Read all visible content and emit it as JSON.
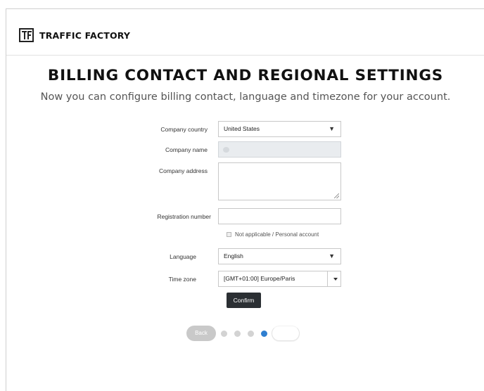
{
  "brand": {
    "logo_icon": "tf-logo-icon",
    "name": "TRAFFIC FACTORY"
  },
  "page": {
    "title": "BILLING CONTACT AND REGIONAL SETTINGS",
    "subtitle": "Now you can configure billing contact, language and timezone for your account."
  },
  "form": {
    "company_country": {
      "label": "Company country",
      "value": "United States"
    },
    "company_name": {
      "label": "Company name",
      "value": ""
    },
    "company_address": {
      "label": "Company address",
      "value": ""
    },
    "registration_number": {
      "label": "Registration number",
      "value": ""
    },
    "not_applicable": {
      "label": "Not applicable / Personal account",
      "checked": false
    },
    "language": {
      "label": "Language",
      "value": "English"
    },
    "time_zone": {
      "label": "Time zone",
      "value": "[GMT+01:00] Europe/Paris"
    },
    "confirm_label": "Confirm"
  },
  "wizard": {
    "back_label": "Back",
    "steps_total": 4,
    "current_step": 4,
    "next_label": ""
  },
  "colors": {
    "confirm_bg": "#2b2f33",
    "active_dot": "#2f7fd0",
    "inactive_dot": "#d3d3d3",
    "disabled_input": "#e9ecef"
  }
}
